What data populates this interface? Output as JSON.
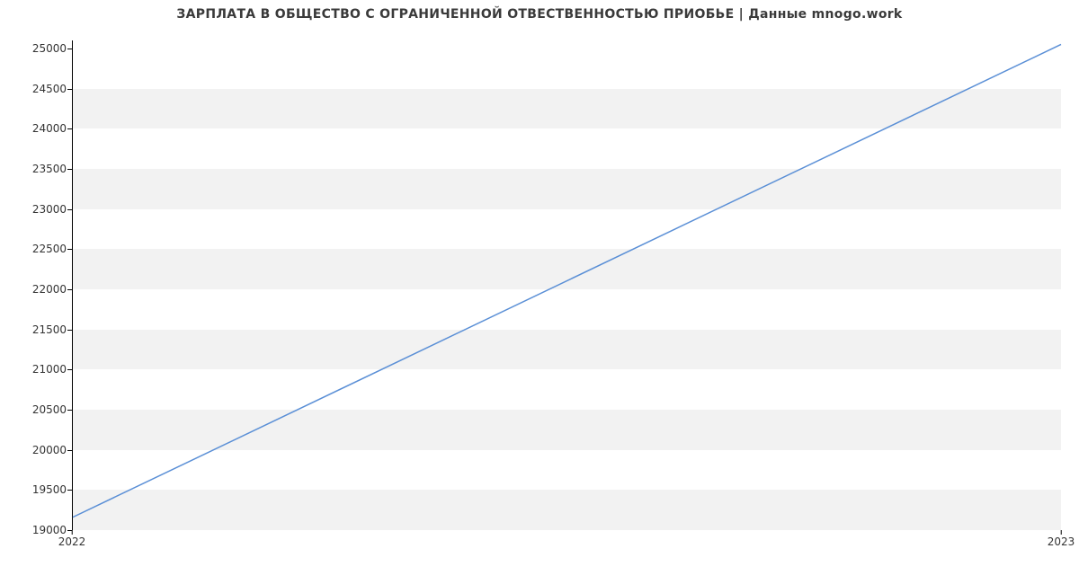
{
  "chart_data": {
    "type": "line",
    "title": "ЗАРПЛАТА В ОБЩЕСТВО С ОГРАНИЧЕННОЙ ОТВЕСТВЕННОСТЬЮ ПРИОБЬЕ | Данные mnogo.work",
    "xlabel": "",
    "ylabel": "",
    "x": [
      "2022",
      "2023"
    ],
    "values": [
      19150,
      25050
    ],
    "x_ticks": [
      "2022",
      "2023"
    ],
    "y_ticks": [
      19000,
      19500,
      20000,
      20500,
      21000,
      21500,
      22000,
      22500,
      23000,
      23500,
      24000,
      24500,
      25000
    ],
    "ylim": [
      19000,
      25100
    ],
    "xlim": [
      0,
      1
    ],
    "grid": true
  }
}
